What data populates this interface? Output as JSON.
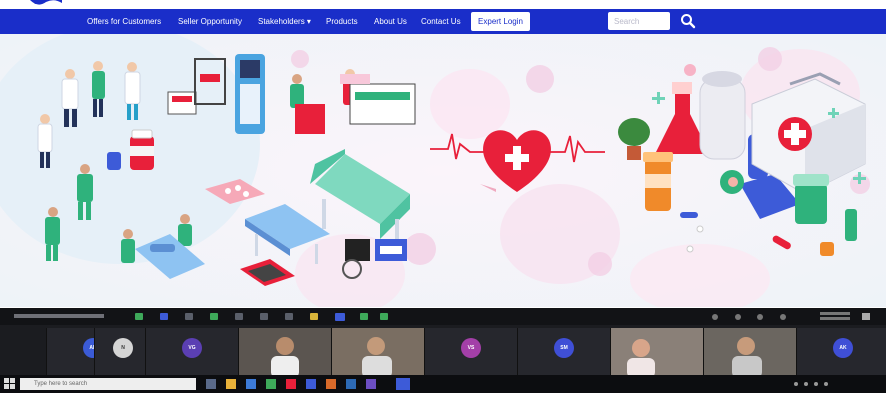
{
  "nav": {
    "items": [
      {
        "label": "Offers for Customers"
      },
      {
        "label": "Seller Opportunity"
      },
      {
        "label": "Stakeholders ▾"
      },
      {
        "label": "Products"
      },
      {
        "label": "About Us"
      },
      {
        "label": "Contact Us"
      }
    ],
    "login_label": "Expert Login",
    "search_placeholder": "Search",
    "search_icon": "search-icon"
  },
  "hero": {
    "icons": [
      "heart-plus-icon",
      "heartbeat-line-icon",
      "first-aid-kit-icon",
      "microscope-icon",
      "flask-icon",
      "hospital-bed-icon",
      "stretcher-icon",
      "wheelchair-icon",
      "medicine-bottle-icon",
      "doctor-icon",
      "nurse-icon"
    ]
  },
  "meeting": {
    "participants": [
      {
        "initials": "AB",
        "color": "#3b5bd6"
      },
      {
        "initials": "N",
        "color": "#d5d5d5"
      },
      {
        "initials": "VG",
        "color": "#5b3fb3"
      },
      {
        "initials": "VS",
        "color": "#a33fa8"
      },
      {
        "initials": "SM",
        "color": "#3f4fd6"
      },
      {
        "initials": "AK",
        "color": "#3f4fd6"
      }
    ]
  },
  "taskbar": {
    "search_placeholder": "Type here to search"
  },
  "colors": {
    "nav_bg": "#1a2ec9",
    "heart": "#e8203a",
    "hero_bg": "#f6f0f6"
  }
}
